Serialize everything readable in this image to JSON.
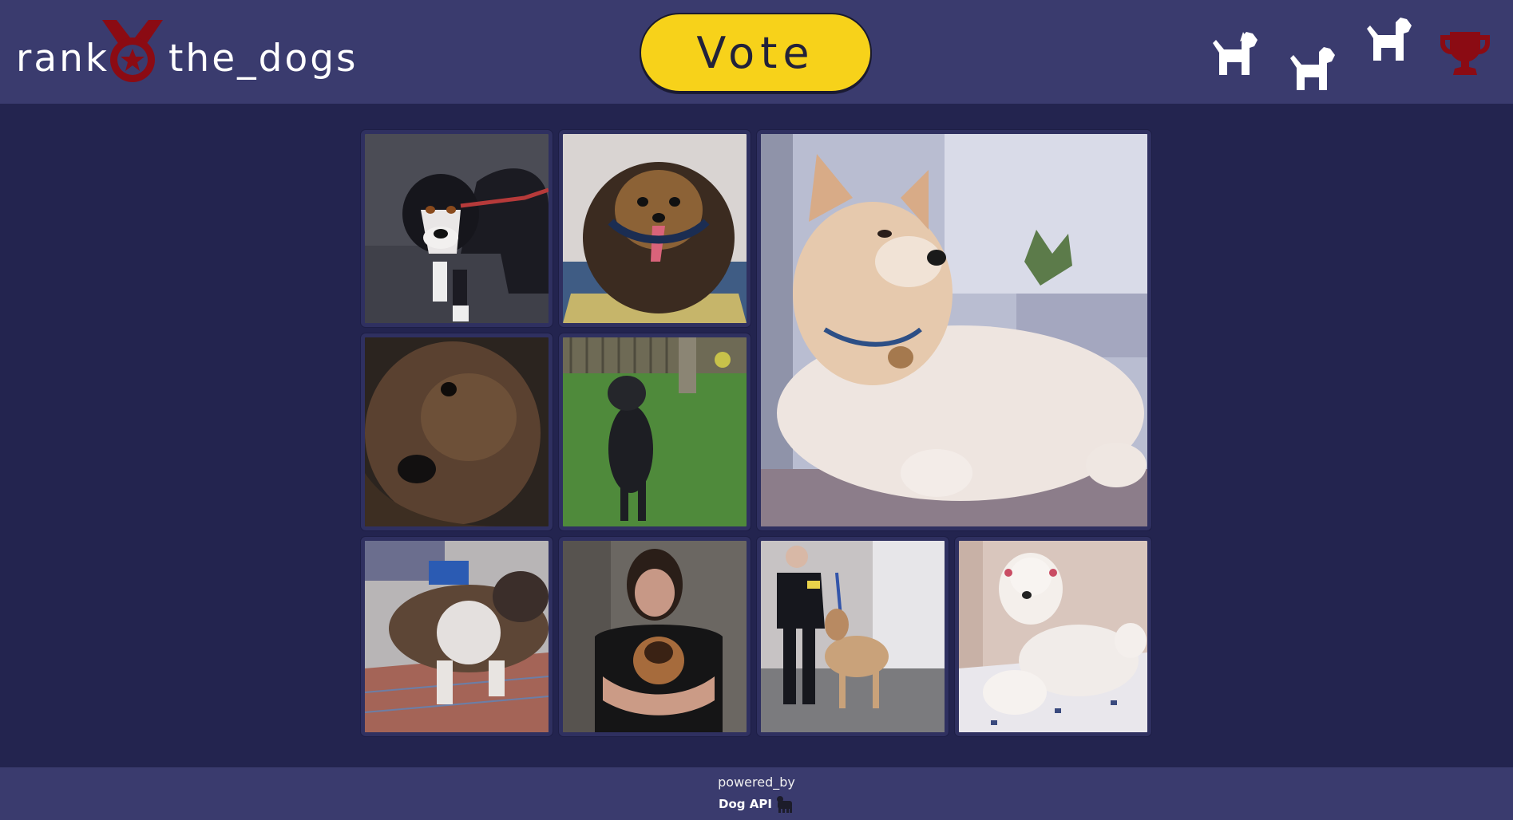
{
  "header": {
    "logo_left": "rank",
    "logo_right": "the_dogs",
    "vote_label": "Vote",
    "nav_icons": [
      "dog-icon",
      "dog-icon",
      "dog-icon",
      "trophy-icon"
    ]
  },
  "gallery": {
    "images": [
      {
        "subject": "tricolor puppy on leash"
      },
      {
        "subject": "yorkshire terrier with tongue out"
      },
      {
        "subject": "akita lying on floor"
      },
      {
        "subject": "brown shaggy dog close-up"
      },
      {
        "subject": "black dog standing on hind legs in grass"
      },
      {
        "subject": "brindle bulldog on rug"
      },
      {
        "subject": "man holding puppy"
      },
      {
        "subject": "man with afghan hound at show"
      },
      {
        "subject": "white poodle lying down"
      }
    ]
  },
  "footer": {
    "powered_label": "powered_by",
    "api_label": "Dog API",
    "api_icon": "dog-api-logo-icon"
  },
  "colors": {
    "page_bg": "#23244f",
    "header_bg": "#3a3b6e",
    "vote_bg": "#f7d21a",
    "accent_red": "#8b0b13"
  }
}
